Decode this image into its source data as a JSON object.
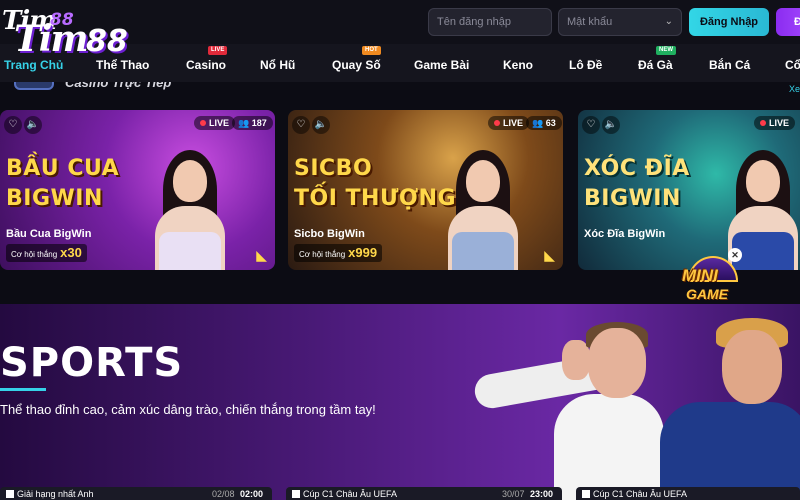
{
  "logo": {
    "line1": "Tim",
    "num1": "88",
    "line2": "Tim",
    "num2": "88"
  },
  "auth": {
    "username_placeholder": "Tên đăng nhập",
    "password_placeholder": "Mật khẩu",
    "login_label": "Đăng Nhập",
    "register_label": "Đ"
  },
  "nav": {
    "items": [
      {
        "label": "Trang Chủ",
        "badge": ""
      },
      {
        "label": "Thể Thao",
        "badge": ""
      },
      {
        "label": "Casino",
        "badge": "LIVE"
      },
      {
        "label": "Nổ Hũ",
        "badge": ""
      },
      {
        "label": "Quay Số",
        "badge": "HOT"
      },
      {
        "label": "Game Bài",
        "badge": ""
      },
      {
        "label": "Keno",
        "badge": ""
      },
      {
        "label": "Lô Đề",
        "badge": ""
      },
      {
        "label": "Đá Gà",
        "badge": "NEW"
      },
      {
        "label": "Bắn Cá",
        "badge": ""
      },
      {
        "label": "Cổ",
        "badge": ""
      }
    ]
  },
  "casino_strip": {
    "title": "Casino Trực Tiếp",
    "more": "Xe"
  },
  "cards": [
    {
      "title_line1": "BẦU CUA",
      "title_line2": "BIGWIN",
      "name": "Bầu Cua BigWin",
      "live": "LIVE",
      "viewers": "187",
      "odds_label": "Cơ hội thắng",
      "odds_value": "x30"
    },
    {
      "title_line1": "SICBO",
      "title_line2": "TỐI THƯỢNG",
      "name": "Sicbo BigWin",
      "live": "LIVE",
      "viewers": "63",
      "odds_label": "Cơ hội thắng",
      "odds_value": "x999"
    },
    {
      "title_line1": "XÓC ĐĨA",
      "title_line2": "BIGWIN",
      "name": "Xóc Đĩa BigWin",
      "live": "LIVE",
      "viewers": "",
      "odds_label": "",
      "odds_value": ""
    }
  ],
  "mini_game": {
    "line1": "MINI",
    "line2": "GAME"
  },
  "sports": {
    "title": "SPORTS",
    "subtitle": "Thể thao đỉnh cao, cảm xúc dâng trào, chiến thắng trong tầm tay!"
  },
  "matches": [
    {
      "league": "Giải hạng nhất Anh",
      "date": "02/08",
      "time": "02:00"
    },
    {
      "league": "Cúp C1 Châu Âu UEFA",
      "date": "30/07",
      "time": "23:00"
    },
    {
      "league": "Cúp C1 Châu Âu UEFA",
      "date": "",
      "time": ""
    }
  ],
  "colors": {
    "accent": "#36d2e8",
    "brand": "#8b2cf0",
    "live": "#e02a3a"
  }
}
